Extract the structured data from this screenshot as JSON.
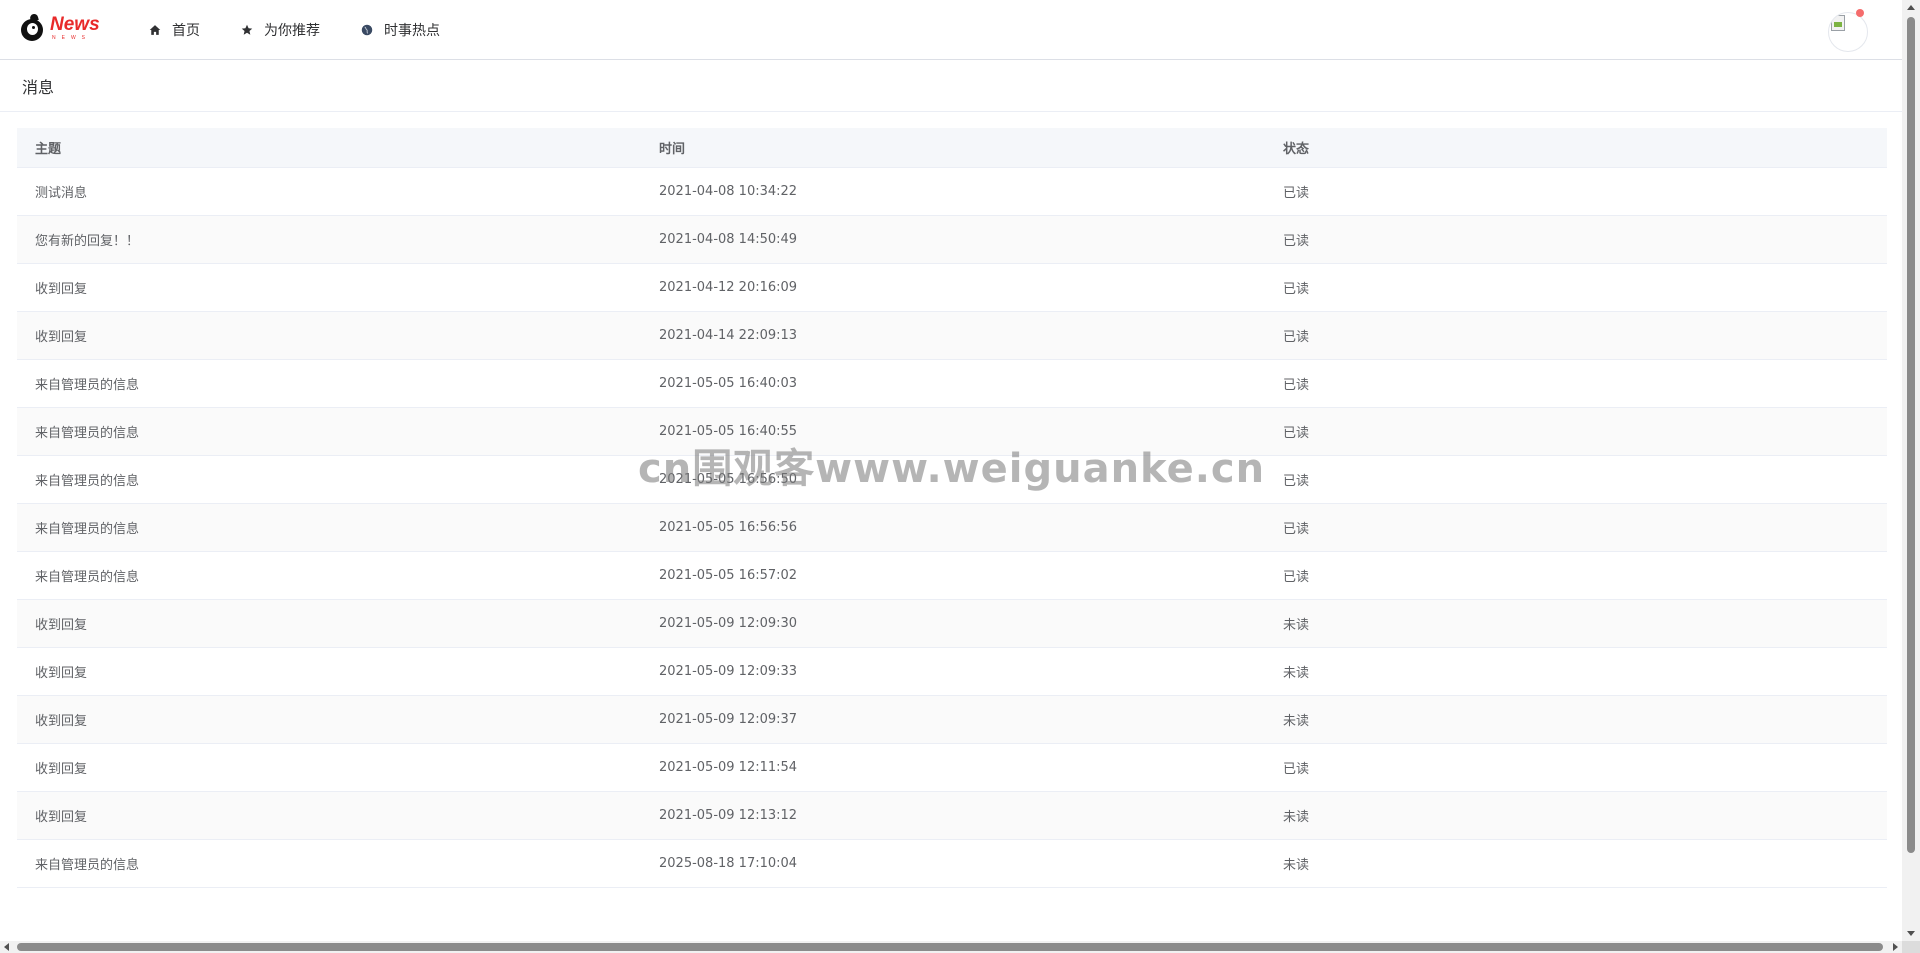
{
  "logo": {
    "title": "News",
    "subtitle": "NEWS"
  },
  "nav": [
    {
      "label": "首页",
      "icon": "home-icon"
    },
    {
      "label": "为你推荐",
      "icon": "star-icon"
    },
    {
      "label": "时事热点",
      "icon": "globe-icon"
    }
  ],
  "header": {
    "notification_dot": true,
    "avatar": "broken-image-icon"
  },
  "section": {
    "title": "消息"
  },
  "table": {
    "columns": [
      "主题",
      "时间",
      "状态"
    ],
    "rows": [
      {
        "subject": "测试消息",
        "time": "2021-04-08 10:34:22",
        "status": "已读"
      },
      {
        "subject": "您有新的回复！！",
        "time": "2021-04-08 14:50:49",
        "status": "已读"
      },
      {
        "subject": "收到回复",
        "time": "2021-04-12 20:16:09",
        "status": "已读"
      },
      {
        "subject": "收到回复",
        "time": "2021-04-14 22:09:13",
        "status": "已读"
      },
      {
        "subject": "来自管理员的信息",
        "time": "2021-05-05 16:40:03",
        "status": "已读"
      },
      {
        "subject": "来自管理员的信息",
        "time": "2021-05-05 16:40:55",
        "status": "已读"
      },
      {
        "subject": "来自管理员的信息",
        "time": "2021-05-05 16:56:50",
        "status": "已读"
      },
      {
        "subject": "来自管理员的信息",
        "time": "2021-05-05 16:56:56",
        "status": "已读"
      },
      {
        "subject": "来自管理员的信息",
        "time": "2021-05-05 16:57:02",
        "status": "已读"
      },
      {
        "subject": "收到回复",
        "time": "2021-05-09 12:09:30",
        "status": "未读"
      },
      {
        "subject": "收到回复",
        "time": "2021-05-09 12:09:33",
        "status": "未读"
      },
      {
        "subject": "收到回复",
        "time": "2021-05-09 12:09:37",
        "status": "未读"
      },
      {
        "subject": "收到回复",
        "time": "2021-05-09 12:11:54",
        "status": "已读"
      },
      {
        "subject": "收到回复",
        "time": "2021-05-09 12:13:12",
        "status": "未读"
      },
      {
        "subject": "来自管理员的信息",
        "time": "2025-08-18 17:10:04",
        "status": "未读"
      }
    ]
  },
  "watermark": "cn围观客www.weiguanke.cn",
  "colors": {
    "brand": "#e82a2a",
    "notification": "#f56c6c",
    "border": "#ebeef5",
    "header_bg": "#f5f7fa"
  }
}
